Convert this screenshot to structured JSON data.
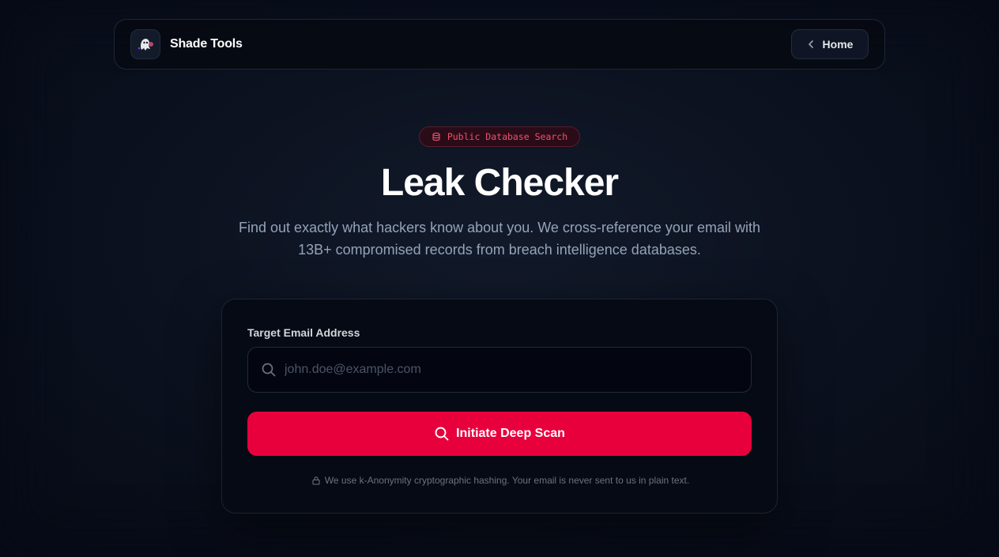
{
  "nav": {
    "brand_name": "Shade Tools",
    "home_label": "Home"
  },
  "hero": {
    "badge_label": "Public Database Search",
    "title": "Leak Checker",
    "subtitle": "Find out exactly what hackers know about you. We cross-reference your email with 13B+ compromised records from breach intelligence databases."
  },
  "form": {
    "email_label": "Target Email Address",
    "email_placeholder": "john.doe@example.com",
    "email_value": "",
    "scan_button_label": "Initiate Deep Scan",
    "privacy_note": "We use k-Anonymity cryptographic hashing. Your email is never sent to us in plain text."
  },
  "icons": {
    "logo": "ghost-logo-icon",
    "home": "chevron-left-icon",
    "badge": "database-icon",
    "input": "search-icon",
    "button": "search-icon",
    "note": "lock-icon"
  },
  "colors": {
    "accent": "#e8003d",
    "badge_text": "#f0506e",
    "background": "#0c1220"
  }
}
